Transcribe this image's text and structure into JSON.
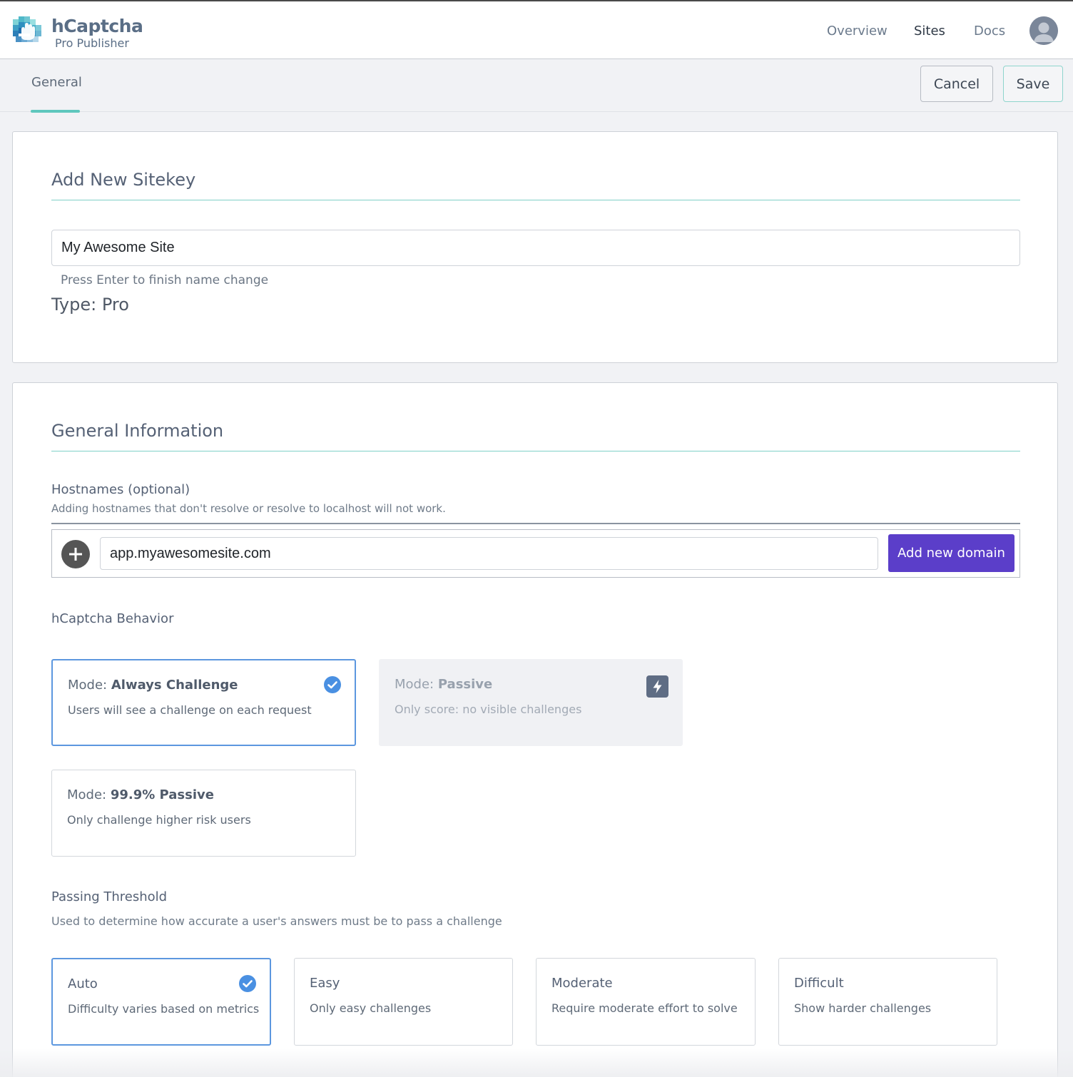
{
  "brand": {
    "name": "hCaptcha",
    "subtitle": "Pro Publisher"
  },
  "nav": {
    "items": [
      {
        "label": "Overview",
        "active": false
      },
      {
        "label": "Sites",
        "active": true
      },
      {
        "label": "Docs",
        "active": false
      }
    ]
  },
  "tabs": {
    "general": "General"
  },
  "toolbar": {
    "cancel_label": "Cancel",
    "save_label": "Save"
  },
  "sitekey": {
    "title": "Add New Sitekey",
    "name_value": "My Awesome Site",
    "hint": "Press Enter to finish name change",
    "type_line": "Type: Pro"
  },
  "general_info": {
    "title": "General Information",
    "hostnames": {
      "label": "Hostnames (optional)",
      "description": "Adding hostnames that don't resolve or resolve to localhost will not work.",
      "input_value": "app.myawesomesite.com",
      "add_button": "Add new domain"
    },
    "behavior": {
      "label": "hCaptcha Behavior",
      "mode_prefix": "Mode:",
      "options": [
        {
          "name": "Always Challenge",
          "description": "Users will see a challenge on each request",
          "selected": true,
          "disabled": false
        },
        {
          "name": "Passive",
          "description": "Only score: no visible challenges",
          "selected": false,
          "disabled": true
        },
        {
          "name": "99.9% Passive",
          "description": "Only challenge higher risk users",
          "selected": false,
          "disabled": false
        }
      ]
    },
    "threshold": {
      "label": "Passing Threshold",
      "description": "Used to determine how accurate a user's answers must be to pass a challenge",
      "options": [
        {
          "name": "Auto",
          "description": "Difficulty varies based on metrics",
          "selected": true
        },
        {
          "name": "Easy",
          "description": "Only easy challenges",
          "selected": false
        },
        {
          "name": "Moderate",
          "description": "Require moderate effort to solve",
          "selected": false
        },
        {
          "name": "Difficult",
          "description": "Show harder challenges",
          "selected": false
        }
      ]
    }
  },
  "colors": {
    "accent_teal": "#5fc7bd",
    "primary_purple": "#5b3ec9",
    "selected_blue": "#5c97df",
    "check_blue": "#4a90e2"
  },
  "icons": {
    "logo": "hcaptcha-hand-logo",
    "avatar": "user-avatar-icon",
    "add": "plus-circle-icon",
    "selected": "check-circle-icon",
    "pro_feature": "lightning-bolt-icon"
  }
}
